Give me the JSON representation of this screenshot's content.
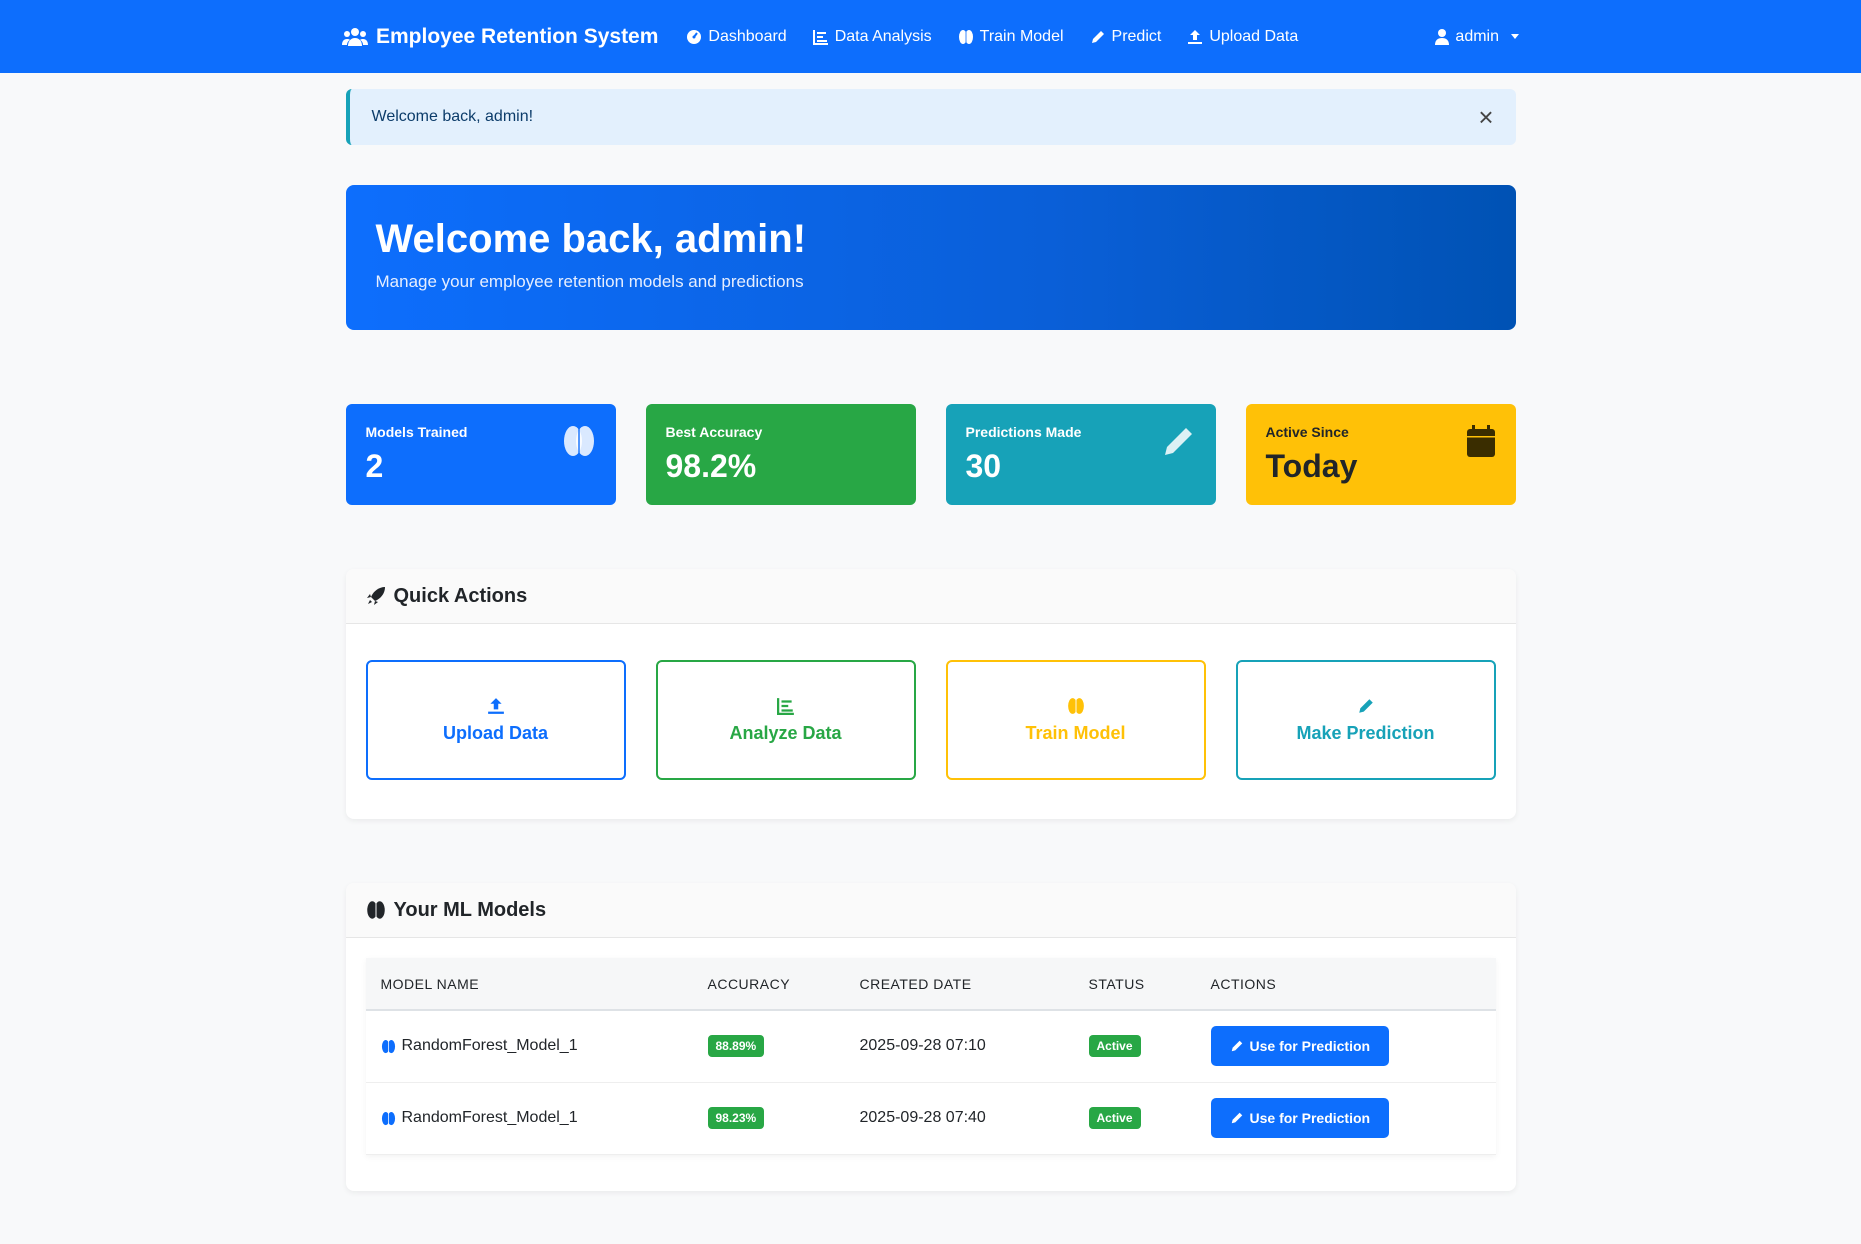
{
  "navbar": {
    "brand": "Employee Retention System",
    "links": [
      "Dashboard",
      "Data Analysis",
      "Train Model",
      "Predict",
      "Upload Data"
    ],
    "user": "admin"
  },
  "alert": {
    "text": "Welcome back, admin!",
    "close": "×"
  },
  "hero": {
    "title": "Welcome back, admin!",
    "subtitle": "Manage your employee retention models and predictions"
  },
  "stats": [
    {
      "label": "Models Trained",
      "value": "2",
      "icon": "brain-icon",
      "color": "#0d6efd"
    },
    {
      "label": "Best Accuracy",
      "value": "98.2%",
      "color": "#28a745"
    },
    {
      "label": "Predictions Made",
      "value": "30",
      "icon": "pencil-icon",
      "color": "#17a2b8"
    },
    {
      "label": "Active Since",
      "value": "Today",
      "icon": "calendar-icon",
      "color": "#ffc107"
    }
  ],
  "quick_actions": {
    "title": "Quick Actions",
    "items": [
      "Upload Data",
      "Analyze Data",
      "Train Model",
      "Make Prediction"
    ]
  },
  "models": {
    "title": "Your ML Models",
    "columns": [
      "MODEL NAME",
      "ACCURACY",
      "CREATED DATE",
      "STATUS",
      "ACTIONS"
    ],
    "rows": [
      {
        "name": "RandomForest_Model_1",
        "accuracy": "88.89%",
        "created": "2025-09-28 07:10",
        "status": "Active",
        "action": "Use for Prediction"
      },
      {
        "name": "RandomForest_Model_1",
        "accuracy": "98.23%",
        "created": "2025-09-28 07:40",
        "status": "Active",
        "action": "Use for Prediction"
      }
    ]
  }
}
